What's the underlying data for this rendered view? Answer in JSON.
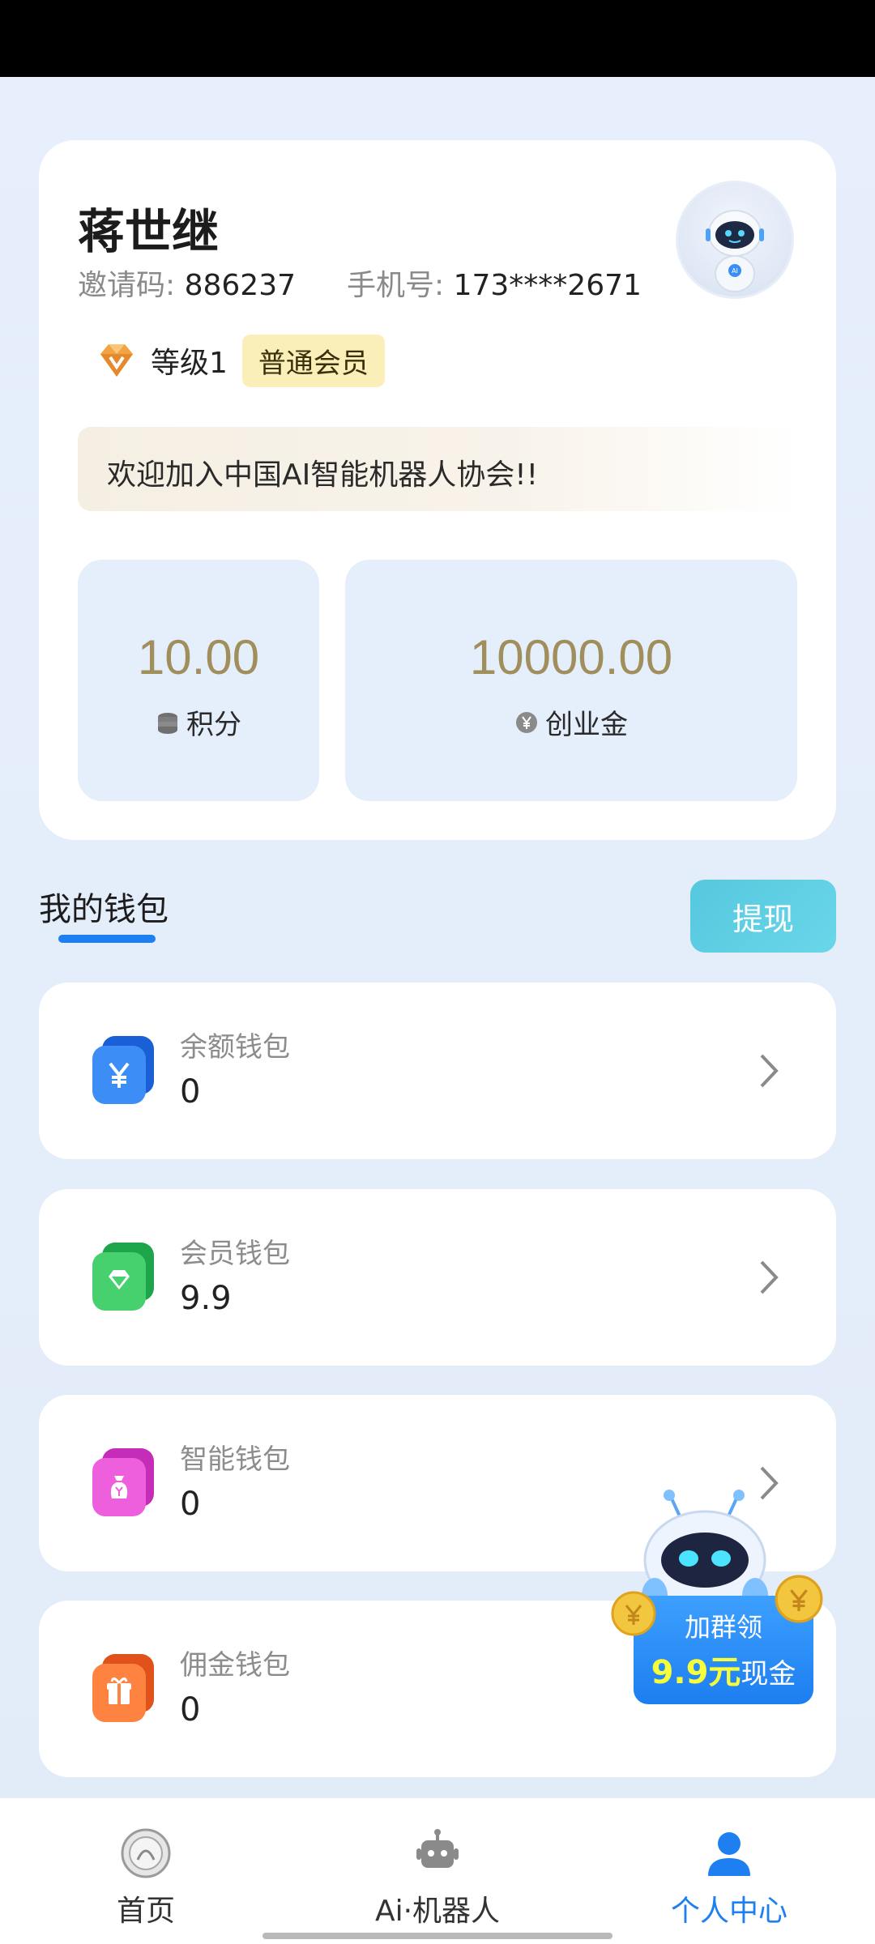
{
  "profile": {
    "name": "蒋世继",
    "invite_label": "邀请码:",
    "invite_code": "886237",
    "phone_label": "手机号:",
    "phone": "173****2671",
    "level": "等级1",
    "member_type": "普通会员",
    "welcome": "欢迎加入中国AI智能机器人协会!!"
  },
  "stats": {
    "points_value": "10.00",
    "points_label": "积分",
    "fund_value": "10000.00",
    "fund_label": "创业金"
  },
  "wallet": {
    "title": "我的钱包",
    "withdraw_label": "提现",
    "items": [
      {
        "name": "余额钱包",
        "value": "0",
        "icon": "yen-wallet-icon",
        "color": "#2a78f0"
      },
      {
        "name": "会员钱包",
        "value": "9.9",
        "icon": "diamond-wallet-icon",
        "color": "#2fc05a"
      },
      {
        "name": "智能钱包",
        "value": "0",
        "icon": "money-bag-wallet-icon",
        "color": "#e44bd0"
      },
      {
        "name": "佣金钱包",
        "value": "0",
        "icon": "gift-wallet-icon",
        "color": "#f5702a"
      }
    ]
  },
  "promo": {
    "line1": "加群领",
    "amount": "9.9元",
    "line2": "现金"
  },
  "tabbar": {
    "items": [
      {
        "label": "首页",
        "icon": "emblem-icon"
      },
      {
        "label": "Ai·机器人",
        "icon": "robot-icon"
      },
      {
        "label": "个人中心",
        "icon": "person-icon",
        "active": true
      }
    ]
  },
  "colors": {
    "accent": "#1e7ff0",
    "stat_value": "#a08e5c",
    "withdraw": "#55c8de",
    "badge_bg": "#fbefb9"
  }
}
